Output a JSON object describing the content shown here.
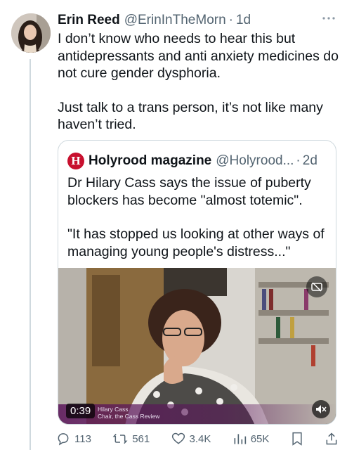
{
  "tweet": {
    "author_name": "Erin Reed",
    "author_handle": "@ErinInTheMorn",
    "separator": "·",
    "time": "1d",
    "paragraph_1": "I don’t know who needs to hear this but antidepressants and anti anxiety medicines do not cure gender dysphoria.",
    "paragraph_2": "Just talk to a trans person, it’s not like many haven’t tried."
  },
  "quote": {
    "logo_letter": "H",
    "author_name": "Holyrood magazine",
    "author_handle": "@Holyrood...",
    "separator": "·",
    "time": "2d",
    "paragraph_1": "Dr Hilary Cass says the issue of puberty blockers has become \"almost totemic\".",
    "paragraph_2": "\"It has stopped us looking at other ways of managing young people's distress...\"",
    "video": {
      "duration": "0:39",
      "caption_line_1": "Hilary Cass",
      "caption_line_2": "Chair, the Cass Review"
    }
  },
  "actions": {
    "replies": "113",
    "reposts": "561",
    "likes": "3.4K",
    "views": "65K"
  },
  "icons": [
    "more-icon",
    "reply-icon",
    "repost-icon",
    "like-icon",
    "views-icon",
    "bookmark-icon",
    "share-icon",
    "mute-icon",
    "captions-off-icon"
  ],
  "colors": {
    "text": "#0f1419",
    "secondary": "#536471",
    "border": "#cfd9de",
    "holyrood_red": "#c8102e"
  }
}
